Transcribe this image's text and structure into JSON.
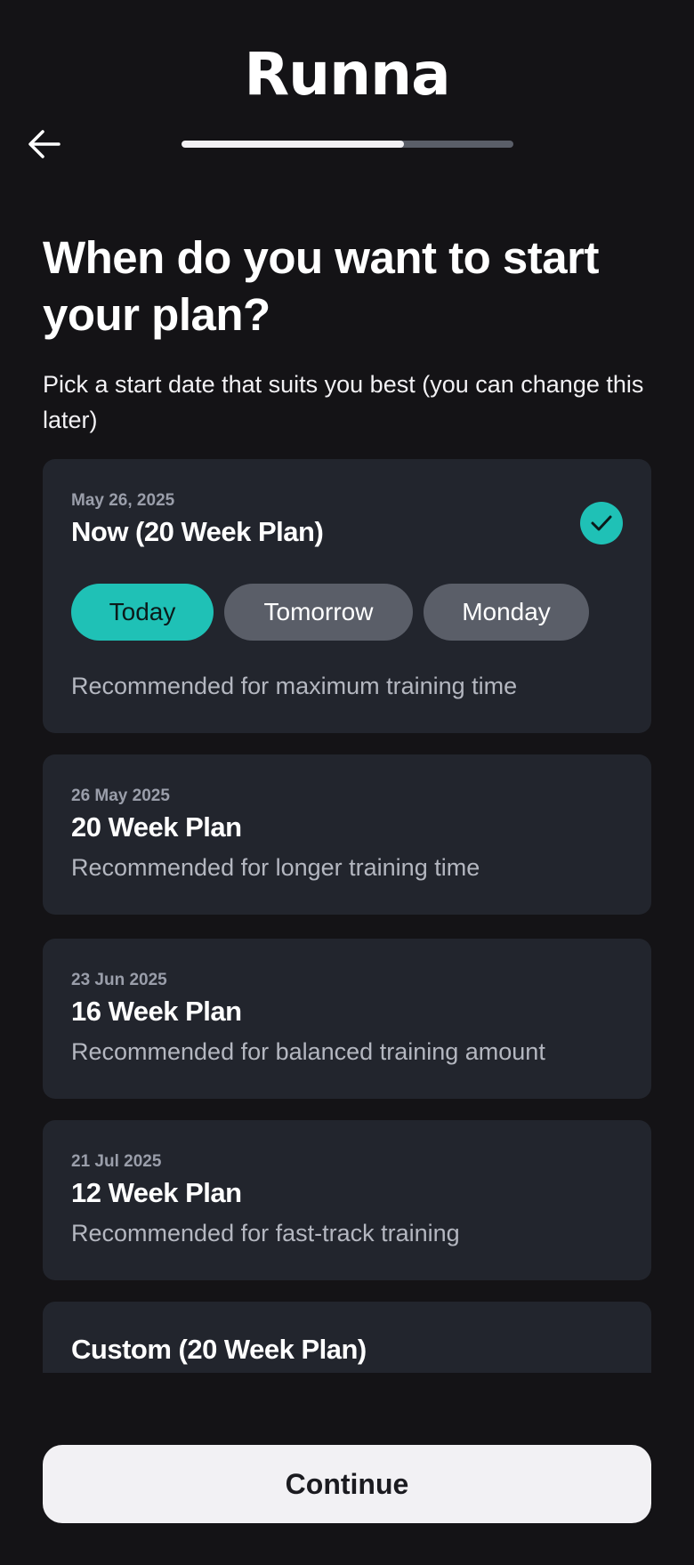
{
  "header": {
    "logo_text": "Runna",
    "progress_fraction": 0.67
  },
  "question": {
    "title": "When do you want to start your plan?",
    "subtitle": "Pick a start date that suits you best (you can change this later)"
  },
  "options": [
    {
      "date": "May 26, 2025",
      "title": "Now (20 Week Plan)",
      "description": "Recommended for maximum training time",
      "selected": true,
      "chips": [
        {
          "label": "Today",
          "active": true
        },
        {
          "label": "Tomorrow",
          "active": false
        },
        {
          "label": "Monday",
          "active": false
        }
      ]
    },
    {
      "date": "26 May 2025",
      "title": "20 Week Plan",
      "description": "Recommended for longer training time",
      "selected": false
    },
    {
      "date": "23 Jun 2025",
      "title": "16 Week Plan",
      "description": "Recommended for balanced training amount",
      "selected": false
    },
    {
      "date": "21 Jul 2025",
      "title": "12 Week Plan",
      "description": "Recommended for fast-track training",
      "selected": false
    },
    {
      "title": "Custom (20 Week Plan)",
      "selected": false
    }
  ],
  "footer": {
    "continue_label": "Continue"
  },
  "colors": {
    "accent": "#1fc1b6",
    "background": "#141316",
    "card": "#22252d"
  },
  "icons": {
    "back": "arrow-left-icon",
    "selected": "check-icon"
  }
}
